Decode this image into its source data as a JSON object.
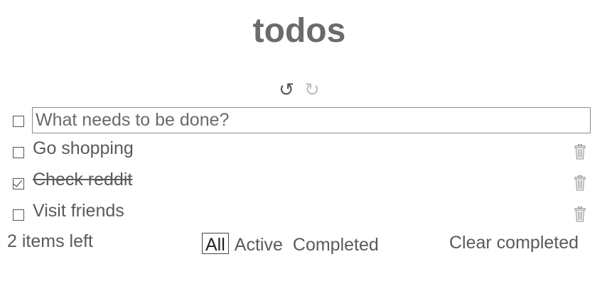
{
  "app": {
    "title": "todos"
  },
  "toolbar": {
    "undo_icon": "undo-icon",
    "undo_glyph": "↺",
    "redo_icon": "redo-icon",
    "redo_glyph": "↻"
  },
  "new_todo": {
    "placeholder": "What needs to be done?",
    "value": "",
    "toggle_all_checked": false
  },
  "todos": [
    {
      "label": "Go shopping",
      "completed": false
    },
    {
      "label": "Check reddit",
      "completed": true
    },
    {
      "label": "Visit friends",
      "completed": false
    }
  ],
  "footer": {
    "items_left": "2 items left",
    "filters": [
      {
        "label": "All",
        "selected": true
      },
      {
        "label": "Active",
        "selected": false
      },
      {
        "label": "Completed",
        "selected": false
      }
    ],
    "clear_completed": "Clear completed"
  },
  "colors": {
    "text": "#5a5a5a",
    "title": "#6b6b6b",
    "redo_disabled": "#c0c0c0"
  }
}
